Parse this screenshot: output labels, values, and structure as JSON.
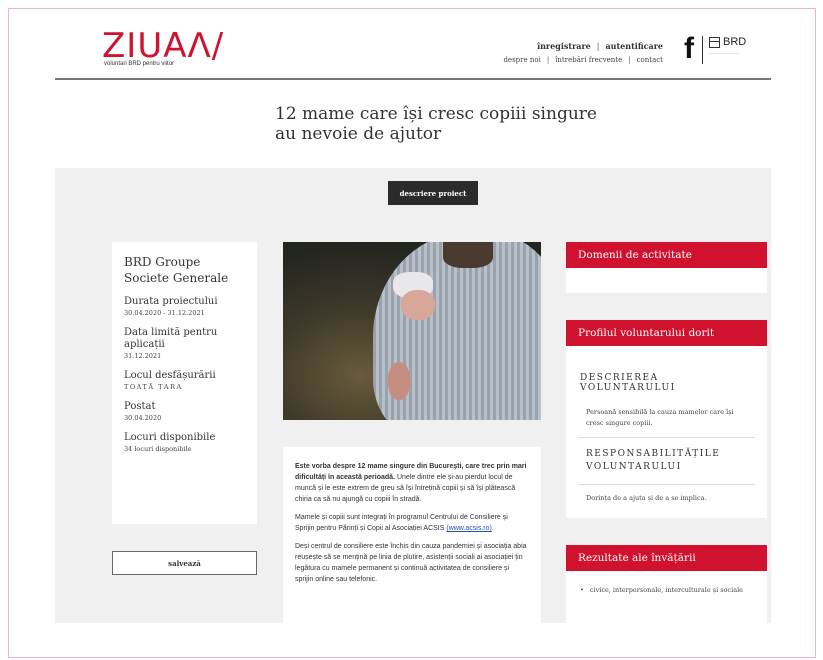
{
  "header": {
    "logo_text": "ZIUAΛ/",
    "logo_tagline": "voluntari BRD pentru viitor",
    "nav_top": [
      "înregistrare",
      "autentificare"
    ],
    "nav_bottom": [
      "despre noi",
      "întrebări frecvente",
      "contact"
    ],
    "social_icon": "facebook-icon",
    "social_glyph": "f",
    "partner_logo": "BRD"
  },
  "page_title": "12 mame care își cresc copiii singure au nevoie de ajutor",
  "tab_button": "descriere proiect",
  "info": {
    "organization": "BRD Groupe Societe Generale",
    "fields": [
      {
        "label": "Durata proiectului",
        "value": "30.04.2020 - 31.12.2021"
      },
      {
        "label": "Data limită pentru aplicații",
        "value": "31.12.2021"
      },
      {
        "label": "Locul desfășurării",
        "value": "TOATĂ ȚARA"
      },
      {
        "label": "Postat",
        "value": "30.04.2020"
      },
      {
        "label": "Locuri disponibile",
        "value": "34 locuri disponibile"
      }
    ],
    "save_button": "salvează"
  },
  "description": {
    "p1_bold": "Este vorba despre 12 mame singure din București, care trec prin mari dificultăți în această perioadă.",
    "p1_rest": "Unele dintre ele și-au pierdut locul de muncă și le este extrem de greu să își întrețină copiii și să își plătească chiria ca să nu ajungă cu copiii în stradă.",
    "p2": "Mamele și copiii sunt integrați în programul Centrului de Consiliere și Sprijin pentru Părinți și Copii al Asociației ACSIS",
    "p2_link": "(www.acsis.ro)",
    "p2_end": ".",
    "p3": "Deși centrul de consiliere este închis din cauza pandemiei și asociația abia reușește să se mențină pe linia de plutire, asistenții sociali ai asociației țin legătura cu mamele permanent și continuă activitatea de consiliere și sprijin online sau telefonic."
  },
  "right": {
    "domains_title": "Domenii de activitate",
    "profile_title": "Profilul voluntarului dorit",
    "volunteer_desc_heading": "DESCRIEREA VOLUNTARULUI",
    "volunteer_desc_text": "Persoană sensibilă la cauza mamelor care își cresc singure copiii.",
    "responsibilities_heading": "RESPONSABILITĂȚILE VOLUNTARULUI",
    "responsibilities_text": "Dorința de a ajuta și de a se implica.",
    "learning_title": "Rezultate ale învățării",
    "learning_items": [
      "civice, interpersonale, interculturale și sociale"
    ]
  },
  "colors": {
    "accent": "#d0122f",
    "dark_button": "#2b2b2b",
    "panel_bg": "#f0f0f0"
  }
}
